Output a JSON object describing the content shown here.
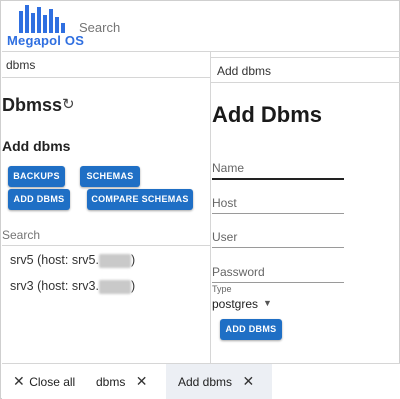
{
  "header": {
    "brand": "Megapol OS",
    "search_placeholder": "Search"
  },
  "left_panel": {
    "tab_label": "dbms",
    "title": "Dbmss",
    "subtitle": "Add dbms",
    "buttons": {
      "backups": "BACKUPS",
      "schemas": "SCHEMAS",
      "add_dbms": "ADD DBMS",
      "compare_schemas": "COMPARE SCHEMAS"
    },
    "search_placeholder": "Search",
    "servers": [
      {
        "name": "srv5",
        "host_prefix": "(host: srv5.",
        "suffix": ")"
      },
      {
        "name": "srv3",
        "host_prefix": "(host: srv3.",
        "suffix": ")"
      }
    ]
  },
  "right_panel": {
    "tab_label": "Add dbms",
    "title": "Add Dbms",
    "fields": {
      "name": "Name",
      "host": "Host",
      "user": "User",
      "password": "Password"
    },
    "type_label": "Type",
    "type_value": "postgres",
    "submit": "ADD DBMS"
  },
  "bottom_tabs": {
    "close_all": "Close all",
    "tabs": [
      {
        "label": "dbms",
        "active": false
      },
      {
        "label": "Add dbms",
        "active": true
      }
    ]
  },
  "colors": {
    "accent": "#1f6fc5",
    "brand": "#2f6fe0"
  }
}
